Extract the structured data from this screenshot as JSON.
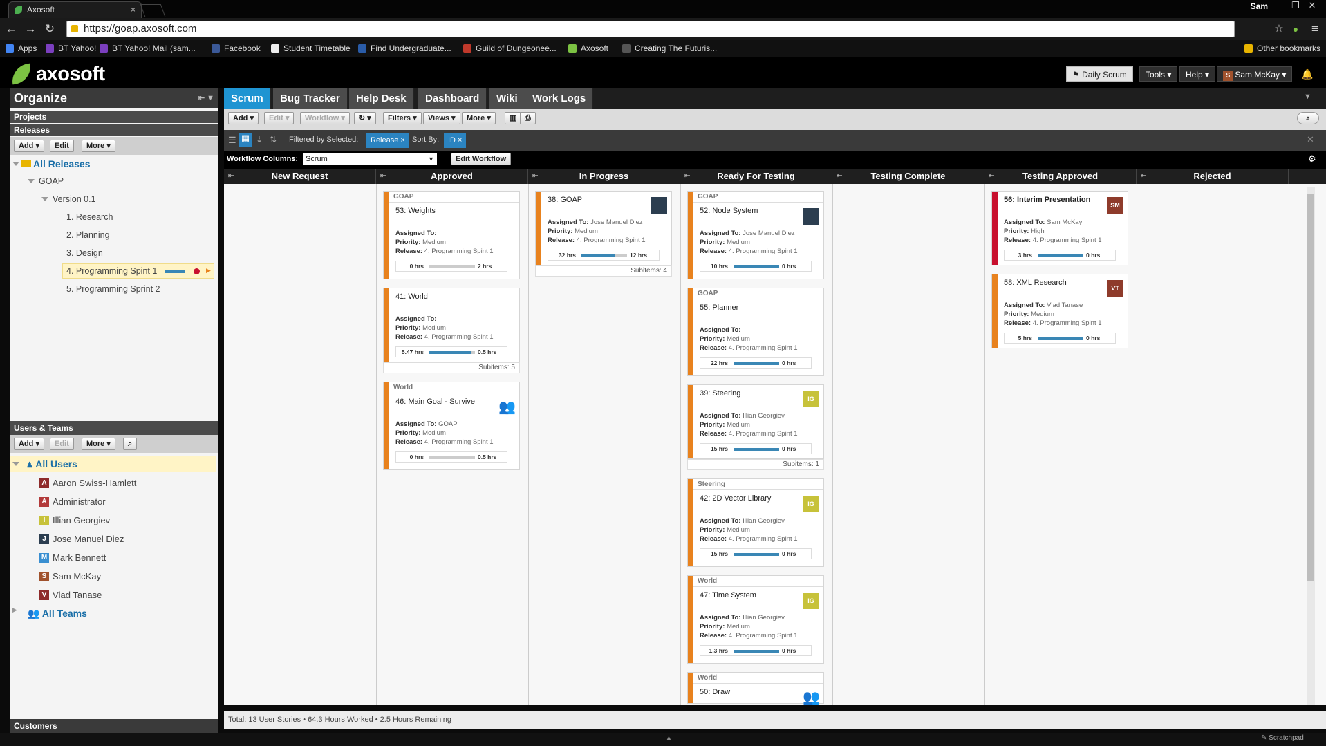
{
  "browser": {
    "tab_title": "Axosoft",
    "url": "https://goap.axosoft.com",
    "user": "Sam",
    "bookmarks": [
      {
        "label": "Apps",
        "color": "#4285f4"
      },
      {
        "label": "BT Yahoo!",
        "color": "#7b3fbf"
      },
      {
        "label": "BT Yahoo! Mail (sam...",
        "color": "#7b3fbf"
      },
      {
        "label": "Facebook",
        "color": "#3b5998"
      },
      {
        "label": "Student Timetable",
        "color": "#eeeeee"
      },
      {
        "label": "Find Undergraduate...",
        "color": "#2a5ca8"
      },
      {
        "label": "Guild of Dungeonee...",
        "color": "#c0392b"
      },
      {
        "label": "Axosoft",
        "color": "#7cc243"
      },
      {
        "label": "Creating The Futuris...",
        "color": "#555555"
      }
    ],
    "other_bookmarks": "Other bookmarks"
  },
  "app": {
    "logo": "axosoft",
    "daily_scrum": "Daily Scrum",
    "tools": "Tools",
    "help": "Help",
    "user": "Sam McKay",
    "user_initial": "S"
  },
  "left": {
    "title": "Organize",
    "projects": "Projects",
    "releases": "Releases",
    "add": "Add",
    "edit": "Edit",
    "more": "More",
    "all_releases": "All Releases",
    "project": "GOAP",
    "version": "Version 0.1",
    "sprints": [
      "1. Research",
      "2. Planning",
      "3. Design",
      "4. Programming Spint 1",
      "5. Programming Sprint 2"
    ],
    "users_teams": "Users & Teams",
    "all_users": "All Users",
    "users": [
      {
        "name": "Aaron Swiss-Hamlett",
        "initial": "A",
        "color": "#8e2b2b"
      },
      {
        "name": "Administrator",
        "initial": "A",
        "color": "#b23a3a"
      },
      {
        "name": "Illian Georgiev",
        "initial": "I",
        "color": "#c7c23a"
      },
      {
        "name": "Jose Manuel Diez",
        "initial": "J",
        "color": "#2c3e50"
      },
      {
        "name": "Mark Bennett",
        "initial": "M",
        "color": "#3a8fd1"
      },
      {
        "name": "Sam McKay",
        "initial": "S",
        "color": "#a0522d"
      },
      {
        "name": "Vlad Tanase",
        "initial": "V",
        "color": "#8e2b2b"
      }
    ],
    "all_teams": "All Teams",
    "customers": "Customers"
  },
  "tabs": [
    "Scrum",
    "Bug Tracker",
    "Help Desk",
    "Dashboard",
    "Wiki",
    "Work Logs"
  ],
  "toolbar": {
    "add": "Add",
    "edit": "Edit",
    "workflow": "Workflow",
    "filters": "Filters",
    "views": "Views",
    "more": "More"
  },
  "filter": {
    "label": "Filtered by Selected:",
    "value": "Release",
    "sort_label": "Sort By:",
    "sort_value": "ID"
  },
  "workflow": {
    "label": "Workflow Columns:",
    "value": "Scrum",
    "edit": "Edit Workflow"
  },
  "columns": [
    "New Request",
    "Approved",
    "In Progress",
    "Ready For Testing",
    "Testing Complete",
    "Testing Approved",
    "Rejected"
  ],
  "labels": {
    "assigned": "Assigned To:",
    "priority": "Priority:",
    "release": "Release:"
  },
  "cards": [
    {
      "col": 1,
      "project": "GOAP",
      "title": "53: Weights",
      "assigned": "",
      "priority": "Medium",
      "release": "4. Programming Spint 1",
      "worked": "0 hrs",
      "remaining": "2 hrs",
      "pct": 0,
      "avatar": "",
      "bar": "#e8821e"
    },
    {
      "col": 1,
      "project": "",
      "title": "41: World",
      "assigned": "",
      "priority": "Medium",
      "release": "4. Programming Spint 1",
      "worked": "5.47 hrs",
      "remaining": "0.5 hrs",
      "pct": 0.92,
      "avatar": "",
      "bar": "#e8821e",
      "subitems": "Subitems: 5"
    },
    {
      "col": 1,
      "project": "World",
      "title": "46: Main Goal - Survive",
      "assigned": "GOAP",
      "priority": "Medium",
      "release": "4. Programming Spint 1",
      "worked": "0 hrs",
      "remaining": "0.5 hrs",
      "pct": 0,
      "avatar": "team",
      "bar": "#e8821e"
    },
    {
      "col": 2,
      "project": "",
      "title": "38: GOAP",
      "assigned": "Jose Manuel Diez",
      "priority": "Medium",
      "release": "4. Programming Spint 1",
      "worked": "32 hrs",
      "remaining": "12 hrs",
      "pct": 0.73,
      "avatar": "photo",
      "bar": "#e8821e",
      "subitems": "Subitems: 4"
    },
    {
      "col": 3,
      "project": "GOAP",
      "title": "52: Node System",
      "assigned": "Jose Manuel Diez",
      "priority": "Medium",
      "release": "4. Programming Spint 1",
      "worked": "10 hrs",
      "remaining": "0 hrs",
      "pct": 1,
      "avatar": "photo",
      "bar": "#e8821e"
    },
    {
      "col": 3,
      "project": "GOAP",
      "title": "55: Planner",
      "assigned": "",
      "priority": "Medium",
      "release": "4. Programming Spint 1",
      "worked": "22 hrs",
      "remaining": "0 hrs",
      "pct": 1,
      "avatar": "",
      "bar": "#e8821e"
    },
    {
      "col": 3,
      "project": "",
      "title": "39: Steering",
      "assigned": "Illian Georgiev",
      "priority": "Medium",
      "release": "4. Programming Spint 1",
      "worked": "15 hrs",
      "remaining": "0 hrs",
      "pct": 1,
      "avatar": "IG",
      "bar": "#e8821e",
      "subitems": "Subitems: 1"
    },
    {
      "col": 3,
      "project": "Steering",
      "title": "42: 2D Vector Library",
      "assigned": "Illian Georgiev",
      "priority": "Medium",
      "release": "4. Programming Spint 1",
      "worked": "15 hrs",
      "remaining": "0 hrs",
      "pct": 1,
      "avatar": "IG",
      "bar": "#e8821e"
    },
    {
      "col": 3,
      "project": "World",
      "title": "47: Time System",
      "assigned": "Illian Georgiev",
      "priority": "Medium",
      "release": "4. Programming Spint 1",
      "worked": "1.3 hrs",
      "remaining": "0 hrs",
      "pct": 1,
      "avatar": "IG",
      "bar": "#e8821e"
    },
    {
      "col": 3,
      "project": "World",
      "title": "50: Draw",
      "assigned": "",
      "priority": "",
      "release": "",
      "worked": "",
      "remaining": "",
      "pct": 0,
      "avatar": "team",
      "bar": "#e8821e"
    },
    {
      "col": 5,
      "project": "",
      "title": "56: Interim Presentation",
      "assigned": "Sam McKay",
      "priority": "High",
      "release": "4. Programming Spint 1",
      "worked": "3 hrs",
      "remaining": "0 hrs",
      "pct": 1,
      "avatar": "SM",
      "bar": "#c8102e"
    },
    {
      "col": 5,
      "project": "",
      "title": "58: XML Research",
      "assigned": "Vlad Tanase",
      "priority": "Medium",
      "release": "4. Programming Spint 1",
      "worked": "5 hrs",
      "remaining": "0 hrs",
      "pct": 1,
      "avatar": "VT",
      "bar": "#e8821e"
    }
  ],
  "status": "Total: 13 User Stories • 64.3 Hours Worked • 2.5 Hours Remaining",
  "scratchpad": "Scratchpad"
}
